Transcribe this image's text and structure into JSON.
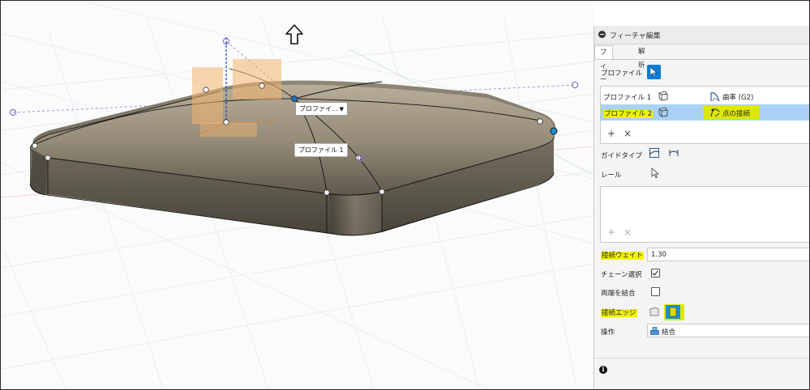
{
  "panel": {
    "title": "フィーチャ編集",
    "tabs": [
      "フィーチャ",
      "解析"
    ],
    "profile_label": "プロファイル",
    "profiles": [
      {
        "name": "プロファイル 1",
        "continuity": "曲率 (G2)"
      },
      {
        "name": "プロファイル 2",
        "continuity": "点の接続"
      }
    ],
    "guide_type_label": "ガイドタイプ",
    "rail_label": "レール",
    "tangent_weight_label": "接続ウェイト",
    "tangent_weight_value": "1.30",
    "chain_select_label": "チェーン選択",
    "chain_select_checked": true,
    "merge_ends_label": "両端を結合",
    "merge_ends_checked": false,
    "tangent_edges_label": "接続エッジ",
    "operation_label": "操作",
    "operation_value": "結合",
    "add_symbol": "+",
    "remove_symbol": "×"
  },
  "viewport": {
    "profile_dropdown_label": "プロファイ...",
    "profile_tag_label": "プロファイル 1"
  },
  "colors": {
    "accent": "#0a7bd3",
    "selected_row": "#a9d2f6",
    "highlight": "#f0f200",
    "body_metal": "#8a8273"
  },
  "icons": [
    "collapse-icon",
    "cursor-icon",
    "profile-surface-icon",
    "curvature-icon",
    "point-connect-icon",
    "guide-rail-icon",
    "guide-centerline-icon",
    "rail-select-icon",
    "edge-face-icon",
    "edge-tangent-icon",
    "join-icon",
    "info-icon",
    "up-arrow-icon"
  ]
}
